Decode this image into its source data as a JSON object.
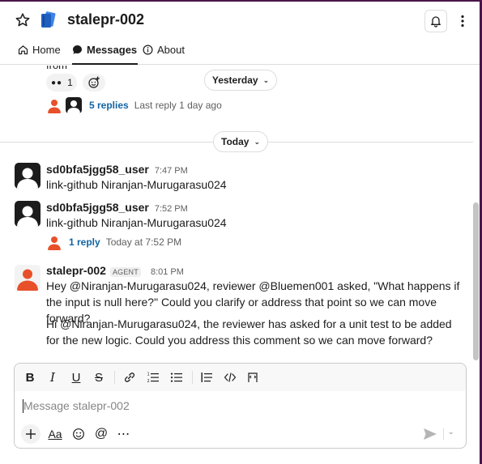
{
  "header": {
    "title": "stalepr-002",
    "star_icon": "star-icon",
    "logo_icon": "blue-notebook-logo",
    "bell_icon": "bell-icon",
    "more_icon": "vertical-dots-icon"
  },
  "tabs": [
    {
      "label": "Home",
      "icon": "home-icon"
    },
    {
      "label": "Messages",
      "icon": "message-bubble-icon",
      "active": true
    },
    {
      "label": "About",
      "icon": "info-icon"
    }
  ],
  "feed": {
    "cut_text": "from",
    "reaction": {
      "emoji": "eyes",
      "glyph": "•• ",
      "count": "1"
    },
    "day_separators": {
      "yesterday": "Yesterday",
      "today": "Today"
    },
    "thread_1": {
      "replies": "5 replies",
      "last": "Last reply 1 day ago"
    },
    "messages": [
      {
        "sender": "sd0bfa5jgg58_user",
        "time": "7:47 PM",
        "text": "link-github Niranjan-Murugarasu024"
      },
      {
        "sender": "sd0bfa5jgg58_user",
        "time": "7:52 PM",
        "text": "link-github Niranjan-Murugarasu024"
      },
      {
        "sender": "stalepr-002",
        "badge": "AGENT",
        "time": "8:01 PM",
        "text1": "Hey @Niranjan-Murugarasu024, reviewer @Bluemen001 asked, \"What happens if the input is null here?\" Could you clarify or address that point so we can move forward?",
        "text2": "Hi @Niranjan-Murugarasu024, the reviewer has asked for a unit test to be added for the new logic. Could you address this comment so we can move forward?"
      }
    ],
    "thread_2": {
      "replies": "1 reply",
      "last": "Today at 7:52 PM"
    }
  },
  "composer": {
    "placeholder": "Message stalepr-002",
    "toolbar_icons": [
      "bold-icon",
      "italic-icon",
      "underline-icon",
      "strikethrough-icon",
      "link-icon",
      "numbered-list-icon",
      "bulleted-list-icon",
      "blockquote-icon",
      "code-icon",
      "code-block-icon"
    ],
    "bottom_icons": [
      "plus-icon",
      "text-format-icon",
      "emoji-icon",
      "mention-icon",
      "more-horizontal-icon"
    ],
    "text_format_label": "Aa",
    "send_icon": "send-icon"
  },
  "colors": {
    "frame": "#4a154b",
    "link": "#1264a3",
    "avatar_orange": "#e8502a",
    "logo_blue": "#1f6fd1"
  }
}
